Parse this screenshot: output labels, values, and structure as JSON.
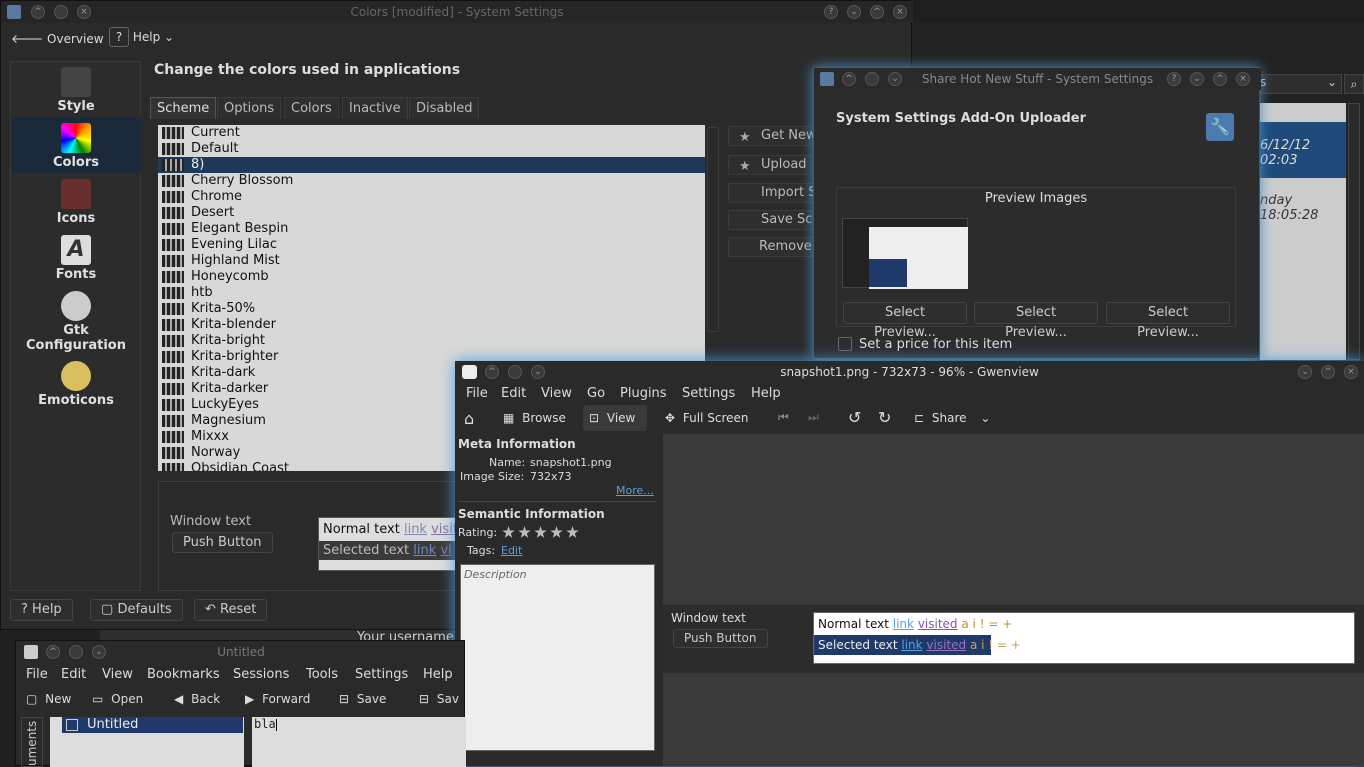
{
  "sys": {
    "title": "Colors [modified] - System Settings",
    "overview": "Overview",
    "help_menu": "Help",
    "heading": "Change the colors used in applications",
    "sidebar": [
      {
        "label": "Style"
      },
      {
        "label": "Colors"
      },
      {
        "label": "Icons"
      },
      {
        "label": "Fonts"
      },
      {
        "label": "Gtk Configuration"
      },
      {
        "label": "Emoticons"
      }
    ],
    "tabs": [
      "Scheme",
      "Options",
      "Colors",
      "Inactive",
      "Disabled"
    ],
    "schemes": [
      "Current",
      "Default",
      "8)",
      "Cherry Blossom",
      "Chrome",
      "Desert",
      "Elegant Bespin",
      "Evening Lilac",
      "Highland Mist",
      "Honeycomb",
      "htb",
      "Krita-50%",
      "Krita-blender",
      "Krita-bright",
      "Krita-brighter",
      "Krita-dark",
      "Krita-darker",
      "LuckyEyes",
      "Magnesium",
      "Mixxx",
      "Norway",
      "Obsidian Coast"
    ],
    "selected_scheme": "8)",
    "right_buttons": [
      "Get New",
      "Upload",
      "Import Sc",
      "Save Sc",
      "Remove"
    ],
    "preview": {
      "window_text": "Window text",
      "push_button": "Push Button",
      "normal_text": "Normal text",
      "link": "link",
      "visited": "visite",
      "selected_text": "Selected text",
      "sel_link": "link",
      "sel_visited": "vi"
    },
    "bottom": {
      "help": "Help",
      "defaults": "Defaults",
      "reset": "Reset"
    },
    "behind_text": "Your username"
  },
  "bg_window": {
    "date1": "6/12/12 02:03",
    "date2": "nday 18:05:28",
    "combo_suffix": "s"
  },
  "share": {
    "title": "Share Hot New Stuff - System Settings",
    "heading": "System Settings Add-On Uploader",
    "preview_images": "Preview Images",
    "select_buttons": [
      "Select Preview...",
      "Select Preview...",
      "Select Preview..."
    ],
    "price_label": "Set a price for this item"
  },
  "gwen": {
    "title": "snapshot1.png - 732x73 - 96% - Gwenview",
    "menus": [
      "File",
      "Edit",
      "View",
      "Go",
      "Plugins",
      "Settings",
      "Help"
    ],
    "toolbar": {
      "browse": "Browse",
      "view": "View",
      "fullscreen": "Full Screen",
      "share": "Share"
    },
    "meta_heading": "Meta Information",
    "name_label": "Name:",
    "name_value": "snapshot1.png",
    "size_label": "Image Size:",
    "size_value": "732x73",
    "more": "More...",
    "semantic_heading": "Semantic Information",
    "rating_label": "Rating:",
    "rating_value": 5,
    "tags_label": "Tags:",
    "tags_edit": "Edit",
    "description_placeholder": "Description",
    "preview": {
      "window_text": "Window text",
      "push_button": "Push Button",
      "normal_text": "Normal text",
      "link": "link",
      "visited": "visited",
      "chars": "a i ! = +",
      "selected_text": "Selected text"
    }
  },
  "kate": {
    "title": "Untitled",
    "menus": [
      "File",
      "Edit",
      "View",
      "Bookmarks",
      "Sessions",
      "Tools",
      "Settings",
      "Help"
    ],
    "toolbar": [
      "New",
      "Open",
      "Back",
      "Forward",
      "Save",
      "Sav"
    ],
    "doc_item": "Untitled",
    "side_tab": "uments",
    "editor_text": "bla"
  }
}
